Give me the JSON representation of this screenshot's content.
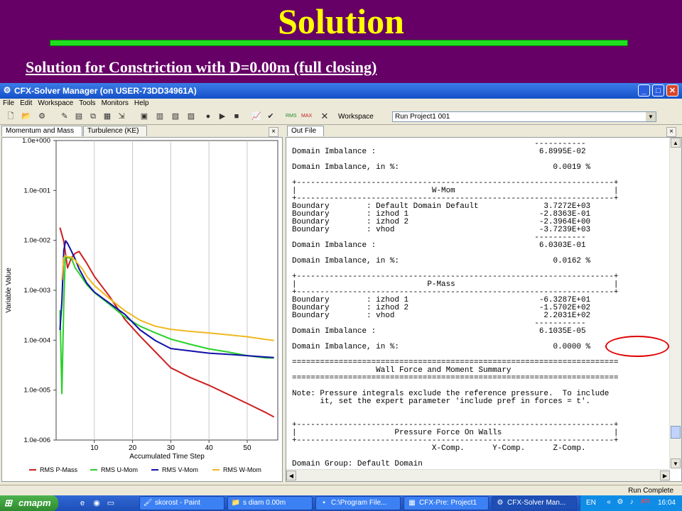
{
  "slide": {
    "title": "Solution",
    "subtitle": "Solution for Constriction with D=0.00m (full closing)"
  },
  "window": {
    "title": "CFX-Solver Manager (on USER-73DD34961A)",
    "menu": [
      "File",
      "Edit",
      "Workspace",
      "Tools",
      "Monitors",
      "Help"
    ],
    "workspace_label": "Workspace",
    "workspace_value": "Run Project1 001",
    "left_tabs": [
      "Momentum and Mass",
      "Turbulence (KE)"
    ],
    "right_tab": "Out File",
    "status": "Run Complete",
    "close_glyph": "×"
  },
  "colors": {
    "p_mass": "#cc2020",
    "u_mom": "#2ad02a",
    "v_mom": "#1010a8",
    "w_mom": "#f0b820",
    "highlight": "#e00000"
  },
  "chart_data": {
    "type": "line",
    "xlabel": "Accumulated Time Step",
    "ylabel": "Variable Value",
    "x_scale": "linear",
    "y_scale": "log",
    "xlim": [
      0,
      58
    ],
    "ylim": [
      1e-06,
      1
    ],
    "xticks": [
      10,
      20,
      30,
      40,
      50
    ],
    "xtick_labels": [
      "10",
      "20",
      "30",
      "40",
      "50"
    ],
    "yticks": [
      1,
      0.1,
      0.01,
      0.001,
      0.0001,
      1e-05,
      1e-06
    ],
    "ytick_labels": [
      "1.0e+000",
      "1.0e-001",
      "1.0e-002",
      "1.0e-003",
      "1.0e-004",
      "1.0e-005",
      "1.0e-006"
    ],
    "grid": "vertical",
    "legend_position": "bottom",
    "series": [
      {
        "name": "RMS P-Mass",
        "color": "#cc2020",
        "x": [
          1,
          2,
          3,
          4,
          5,
          6,
          8,
          10,
          14,
          18,
          22,
          26,
          30,
          35,
          40,
          45,
          50,
          55,
          57
        ],
        "y": [
          0.018,
          0.0095,
          0.0028,
          0.0045,
          0.0055,
          0.006,
          0.0035,
          0.0019,
          0.00075,
          0.00026,
          0.00012,
          5.8e-05,
          2.8e-05,
          1.8e-05,
          1.25e-05,
          8.2e-06,
          5.4e-06,
          3.5e-06,
          2.9e-06
        ]
      },
      {
        "name": "RMS U-Mom",
        "color": "#2ad02a",
        "x": [
          1,
          1.5,
          2,
          2.4,
          3,
          4,
          5,
          6,
          8,
          10,
          14,
          18,
          22,
          26,
          30,
          35,
          40,
          45,
          50,
          55,
          57
        ],
        "y": [
          0.0004,
          8.5e-06,
          0.00055,
          0.0048,
          0.0045,
          0.0044,
          0.0028,
          0.0022,
          0.0013,
          0.0009,
          0.00052,
          0.00029,
          0.00019,
          0.00014,
          0.000105,
          8.3e-05,
          6.7e-05,
          5.8e-05,
          4.9e-05,
          4.4e-05,
          4.4e-05
        ]
      },
      {
        "name": "RMS V-Mom",
        "color": "#1010a8",
        "x": [
          1,
          1.5,
          2,
          2.5,
          3,
          4,
          5,
          6,
          8,
          10,
          14,
          18,
          22,
          26,
          30,
          35,
          40,
          45,
          50,
          55,
          57
        ],
        "y": [
          0.00016,
          0.0006,
          0.0063,
          0.0098,
          0.0087,
          0.0061,
          0.0042,
          0.0027,
          0.0014,
          0.00092,
          0.00055,
          0.00033,
          0.00016,
          9.8e-05,
          6.8e-05,
          6.1e-05,
          5.5e-05,
          5.2e-05,
          4.9e-05,
          4.6e-05,
          4.5e-05
        ]
      },
      {
        "name": "RMS W-Mom",
        "color": "#f0b820",
        "x": [
          1.5,
          2,
          2.5,
          3,
          4,
          5,
          6,
          7,
          8,
          10,
          14,
          18,
          22,
          26,
          30,
          35,
          40,
          45,
          50,
          55,
          57
        ],
        "y": [
          0.0016,
          0.0045,
          0.0049,
          0.0047,
          0.0046,
          0.004,
          0.0032,
          0.0026,
          0.0019,
          0.00125,
          0.00068,
          0.00039,
          0.00025,
          0.00019,
          0.000165,
          0.00015,
          0.00014,
          0.000128,
          0.000117,
          0.000103,
          9.9e-05
        ]
      }
    ]
  },
  "out_file_lines": [
    "                                                    -----------",
    "Domain Imbalance :                                   6.8995E-02",
    "",
    "Domain Imbalance, in %:                                 0.0019 %",
    "",
    "+--------------------------------------------------------------------+",
    "|                             W-Mom                                  |",
    "+--------------------------------------------------------------------+",
    "Boundary        : Default Domain Default              3.7272E+03",
    "Boundary        : izhod 1                            -2.8363E-01",
    "Boundary        : izhod 2                            -2.3964E+00",
    "Boundary        : vhod                               -3.7239E+03",
    "                                                    -----------",
    "Domain Imbalance :                                   6.0303E-01",
    "",
    "Domain Imbalance, in %:                                 0.0162 %",
    "",
    "+--------------------------------------------------------------------+",
    "|                            P-Mass                                  |",
    "+--------------------------------------------------------------------+",
    "Boundary        : izhod 1                            -6.3287E+01",
    "Boundary        : izhod 2                            -1.5702E+02",
    "Boundary        : vhod                                2.2031E+02",
    "                                                    -----------",
    "Domain Imbalance :                                   6.1035E-05",
    "",
    "Domain Imbalance, in %:                                 0.0000 %",
    "",
    "======================================================================",
    "                  Wall Force and Moment Summary",
    "======================================================================",
    "",
    "Note: Pressure integrals exclude the reference pressure.  To include",
    "      it, set the expert parameter 'include pref in forces = t'.",
    "",
    "",
    "+--------------------------------------------------------------------+",
    "|                     Pressure Force On Walls                        |",
    "+--------------------------------------------------------------------+",
    "                              X-Comp.      Y-Comp.      Z-Comp.",
    "",
    "Domain Group: Default Domain"
  ],
  "taskbar": {
    "start": "старт",
    "tasks": [
      "skorost - Paint",
      "s diam 0.00m",
      "C:\\Program File...",
      "CFX-Pre: Project1",
      "CFX-Solver Man..."
    ],
    "lang": "EN",
    "clock": "16:04",
    "ati": "ATI"
  }
}
